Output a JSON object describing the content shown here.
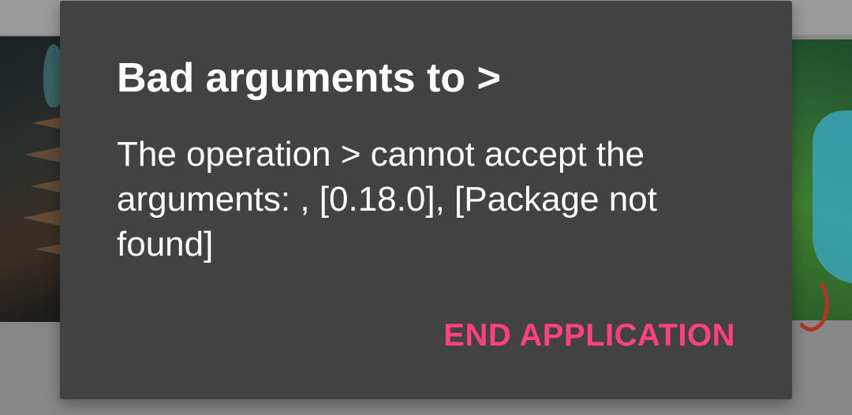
{
  "dialog": {
    "title": "Bad arguments to >",
    "message": "The operation > cannot accept the arguments: , [0.18.0], [Package not found]",
    "actions": {
      "end_application_label": "END APPLICATION"
    }
  },
  "colors": {
    "dialog_background": "#424242",
    "scrim": "#878787",
    "accent": "#ff4081",
    "text_primary": "#ffffff"
  }
}
